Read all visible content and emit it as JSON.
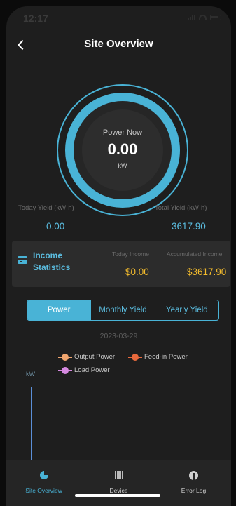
{
  "status_bar": {
    "time": "12:17"
  },
  "header": {
    "title": "Site Overview"
  },
  "gauge": {
    "label": "Power Now",
    "value": "0.00",
    "unit": "kW"
  },
  "yield": {
    "today_label": "Today Yield (kW·h)",
    "today_value": "0.00",
    "total_label": "Total Yield (kW·h)",
    "total_value": "3617.90"
  },
  "income": {
    "title": "Income Statistics",
    "today_label": "Today Income",
    "today_value": "$0.00",
    "accumulated_label": "Accumulated Income",
    "accumulated_value": "$3617.90"
  },
  "tabs": [
    {
      "label": "Power",
      "active": true
    },
    {
      "label": "Monthly Yield",
      "active": false
    },
    {
      "label": "Yearly Yield",
      "active": false
    }
  ],
  "chart": {
    "date": "2023-03-29",
    "unit": "kW",
    "legend": [
      {
        "label": "Output Power",
        "color": "#f0a56e"
      },
      {
        "label": "Feed-in Power",
        "color": "#e8693c"
      },
      {
        "label": "Load Power",
        "color": "#d68ae0"
      }
    ]
  },
  "nav": [
    {
      "label": "Site Overview",
      "icon": "pie-chart-icon",
      "active": true
    },
    {
      "label": "Device",
      "icon": "device-icon",
      "active": false
    },
    {
      "label": "Error Log",
      "icon": "alert-icon",
      "active": false
    }
  ],
  "colors": {
    "accent": "#49b3d6",
    "income": "#f4bc2c",
    "background": "#1e1e1e"
  }
}
